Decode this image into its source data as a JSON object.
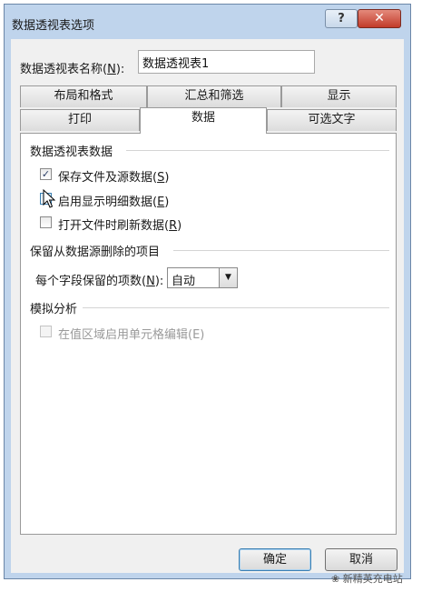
{
  "window": {
    "title": "数据透视表选项",
    "help_label": "?",
    "close_label": "✕"
  },
  "name_field": {
    "label": "数据透视表名称(N):",
    "value": "数据透视表1"
  },
  "tabs": {
    "row1": [
      "布局和格式",
      "汇总和筛选",
      "显示"
    ],
    "row2": [
      "打印",
      "数据",
      "可选文字"
    ],
    "active": "数据"
  },
  "sections": {
    "pivot_data": {
      "title": "数据透视表数据",
      "save_source": {
        "label": "保存文件及源数据(S)",
        "checked": true
      },
      "enable_details": {
        "label": "启用显示明细数据(E)",
        "checked": false
      },
      "refresh_on_open": {
        "label": "打开文件时刷新数据(R)",
        "checked": false
      }
    },
    "retain_items": {
      "title": "保留从数据源删除的项目",
      "items_label": "每个字段保留的项数(N):",
      "items_value": "自动"
    },
    "what_if": {
      "title": "模拟分析",
      "enable_edit": {
        "label": "在值区域启用单元格编辑(E)",
        "checked": false,
        "disabled": true
      }
    }
  },
  "buttons": {
    "ok": "确定",
    "cancel": "取消"
  },
  "watermark": "新精英充电站"
}
